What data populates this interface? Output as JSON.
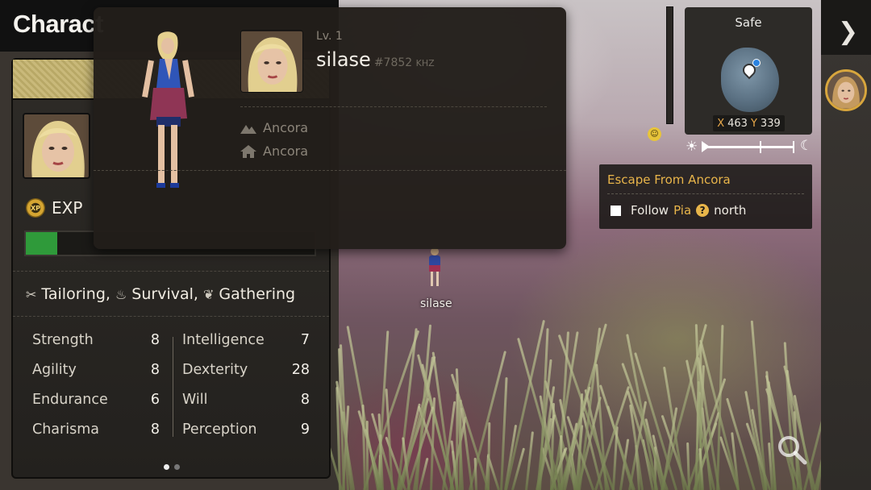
{
  "panel": {
    "title": "Charact",
    "exp_label": "EXP",
    "exp_icon_text": "XP",
    "exp_progress": 0.11,
    "skills": [
      "Tailoring,",
      "Survival,",
      "Gathering"
    ],
    "stats_left": [
      {
        "name": "Strength",
        "value": "8"
      },
      {
        "name": "Agility",
        "value": "8"
      },
      {
        "name": "Endurance",
        "value": "6"
      },
      {
        "name": "Charisma",
        "value": "8"
      }
    ],
    "stats_right": [
      {
        "name": "Intelligence",
        "value": "7"
      },
      {
        "name": "Dexterity",
        "value": "28"
      },
      {
        "name": "Will",
        "value": "8"
      },
      {
        "name": "Perception",
        "value": "9"
      }
    ],
    "page_count": 2,
    "active_page": 0
  },
  "popup": {
    "level": "Lv. 1",
    "name": "silase",
    "id": "#7852",
    "id_suffix": "KHZ",
    "location": "Ancora",
    "home": "Ancora"
  },
  "minimap": {
    "status": "Safe",
    "x_label": "X",
    "x": "463",
    "y_label": "Y",
    "y": "339"
  },
  "quest": {
    "title": "Escape From Ancora",
    "objective_prefix": "Follow",
    "npc": "Pia",
    "objective_suffix": "north"
  },
  "world": {
    "player_label": "silase"
  },
  "colors": {
    "accent": "#e8b54a",
    "exp_fill": "#2f9a3a",
    "panel_bg": "#2e2b27"
  },
  "icons": {
    "rail_arrow": "chevron-right-icon",
    "search": "magnifier-icon"
  }
}
